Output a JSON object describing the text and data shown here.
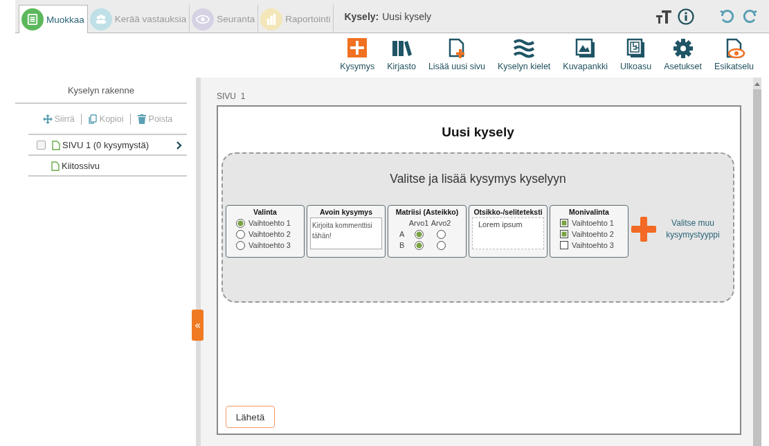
{
  "tabs": [
    {
      "label": "Muokkaa",
      "kind": "edit",
      "color": "#5cb85c",
      "selected": true,
      "disabled": false
    },
    {
      "label": "Kerää vastauksia",
      "kind": "collect",
      "color": "#bfe0e6",
      "selected": false,
      "disabled": true
    },
    {
      "label": "Seuranta",
      "kind": "monitor",
      "color": "#d6d2e4",
      "selected": false,
      "disabled": true
    },
    {
      "label": "Raportointi",
      "kind": "report",
      "color": "#f3e6b8",
      "selected": false,
      "disabled": true
    }
  ],
  "survey": {
    "label": "Kysely:",
    "name": "Uusi kysely"
  },
  "toolbar": [
    {
      "label": "Kysymys",
      "kind": "plus"
    },
    {
      "label": "Kirjasto",
      "kind": "library"
    },
    {
      "label": "Lisää uusi sivu",
      "kind": "newpage"
    },
    {
      "label": "Kyselyn kielet",
      "kind": "languages"
    },
    {
      "label": "Kuvapankki",
      "kind": "images"
    },
    {
      "label": "Ulkoasu",
      "kind": "layout"
    },
    {
      "label": "Asetukset",
      "kind": "settings"
    },
    {
      "label": "Esikatselu",
      "kind": "preview"
    }
  ],
  "sidebar": {
    "title": "Kyselyn rakenne",
    "actions": [
      {
        "label": "Siirrä",
        "kind": "move"
      },
      {
        "label": "Kopioi",
        "kind": "copy"
      },
      {
        "label": "Poista",
        "kind": "trash"
      }
    ],
    "pages": [
      {
        "label": "SIVU 1 (0 kysymystä)",
        "kind": "question",
        "checked": false
      },
      {
        "label": "Kiitossivu",
        "kind": "thanks"
      }
    ]
  },
  "collapse_button": "«",
  "page": {
    "label": "SIVU  1",
    "title": "Uusi kysely",
    "dropzone": {
      "title": "Valitse ja lisää kysymys kyselyyn",
      "cards": [
        {
          "kind": "choice",
          "title": "Valinta",
          "options": [
            {
              "label": "Vaihtoehto 1",
              "selected": true
            },
            {
              "label": "Vaihtoehto 2",
              "selected": false
            },
            {
              "label": "Vaihtoehto 3",
              "selected": false
            }
          ]
        },
        {
          "kind": "open",
          "title": "Avoin kysymys",
          "text": "Kirjoita kommenttisi tähän!"
        },
        {
          "kind": "matrix",
          "title": "Matriisi (Asteikko)",
          "columns": [
            "Arvo1",
            "Arvo2"
          ],
          "rows": [
            {
              "label": "A",
              "choices": [
                {
                  "selected": true
                },
                {
                  "selected": false
                }
              ]
            },
            {
              "label": "B",
              "choices": [
                {
                  "selected": true
                },
                {
                  "selected": false
                }
              ]
            }
          ]
        },
        {
          "kind": "text",
          "title": "Otsikko-/seliteteksti",
          "text": "Lorem ipsum"
        },
        {
          "kind": "multi",
          "title": "Monivalinta",
          "options": [
            {
              "label": "Vaihtoehto 1",
              "checked": true
            },
            {
              "label": "Vaihtoehto 2",
              "checked": true
            },
            {
              "label": "Vaihtoehto 3",
              "checked": false
            }
          ]
        }
      ],
      "more": "Valitse muu kysymystyyppi"
    },
    "submit": "Lähetä"
  }
}
